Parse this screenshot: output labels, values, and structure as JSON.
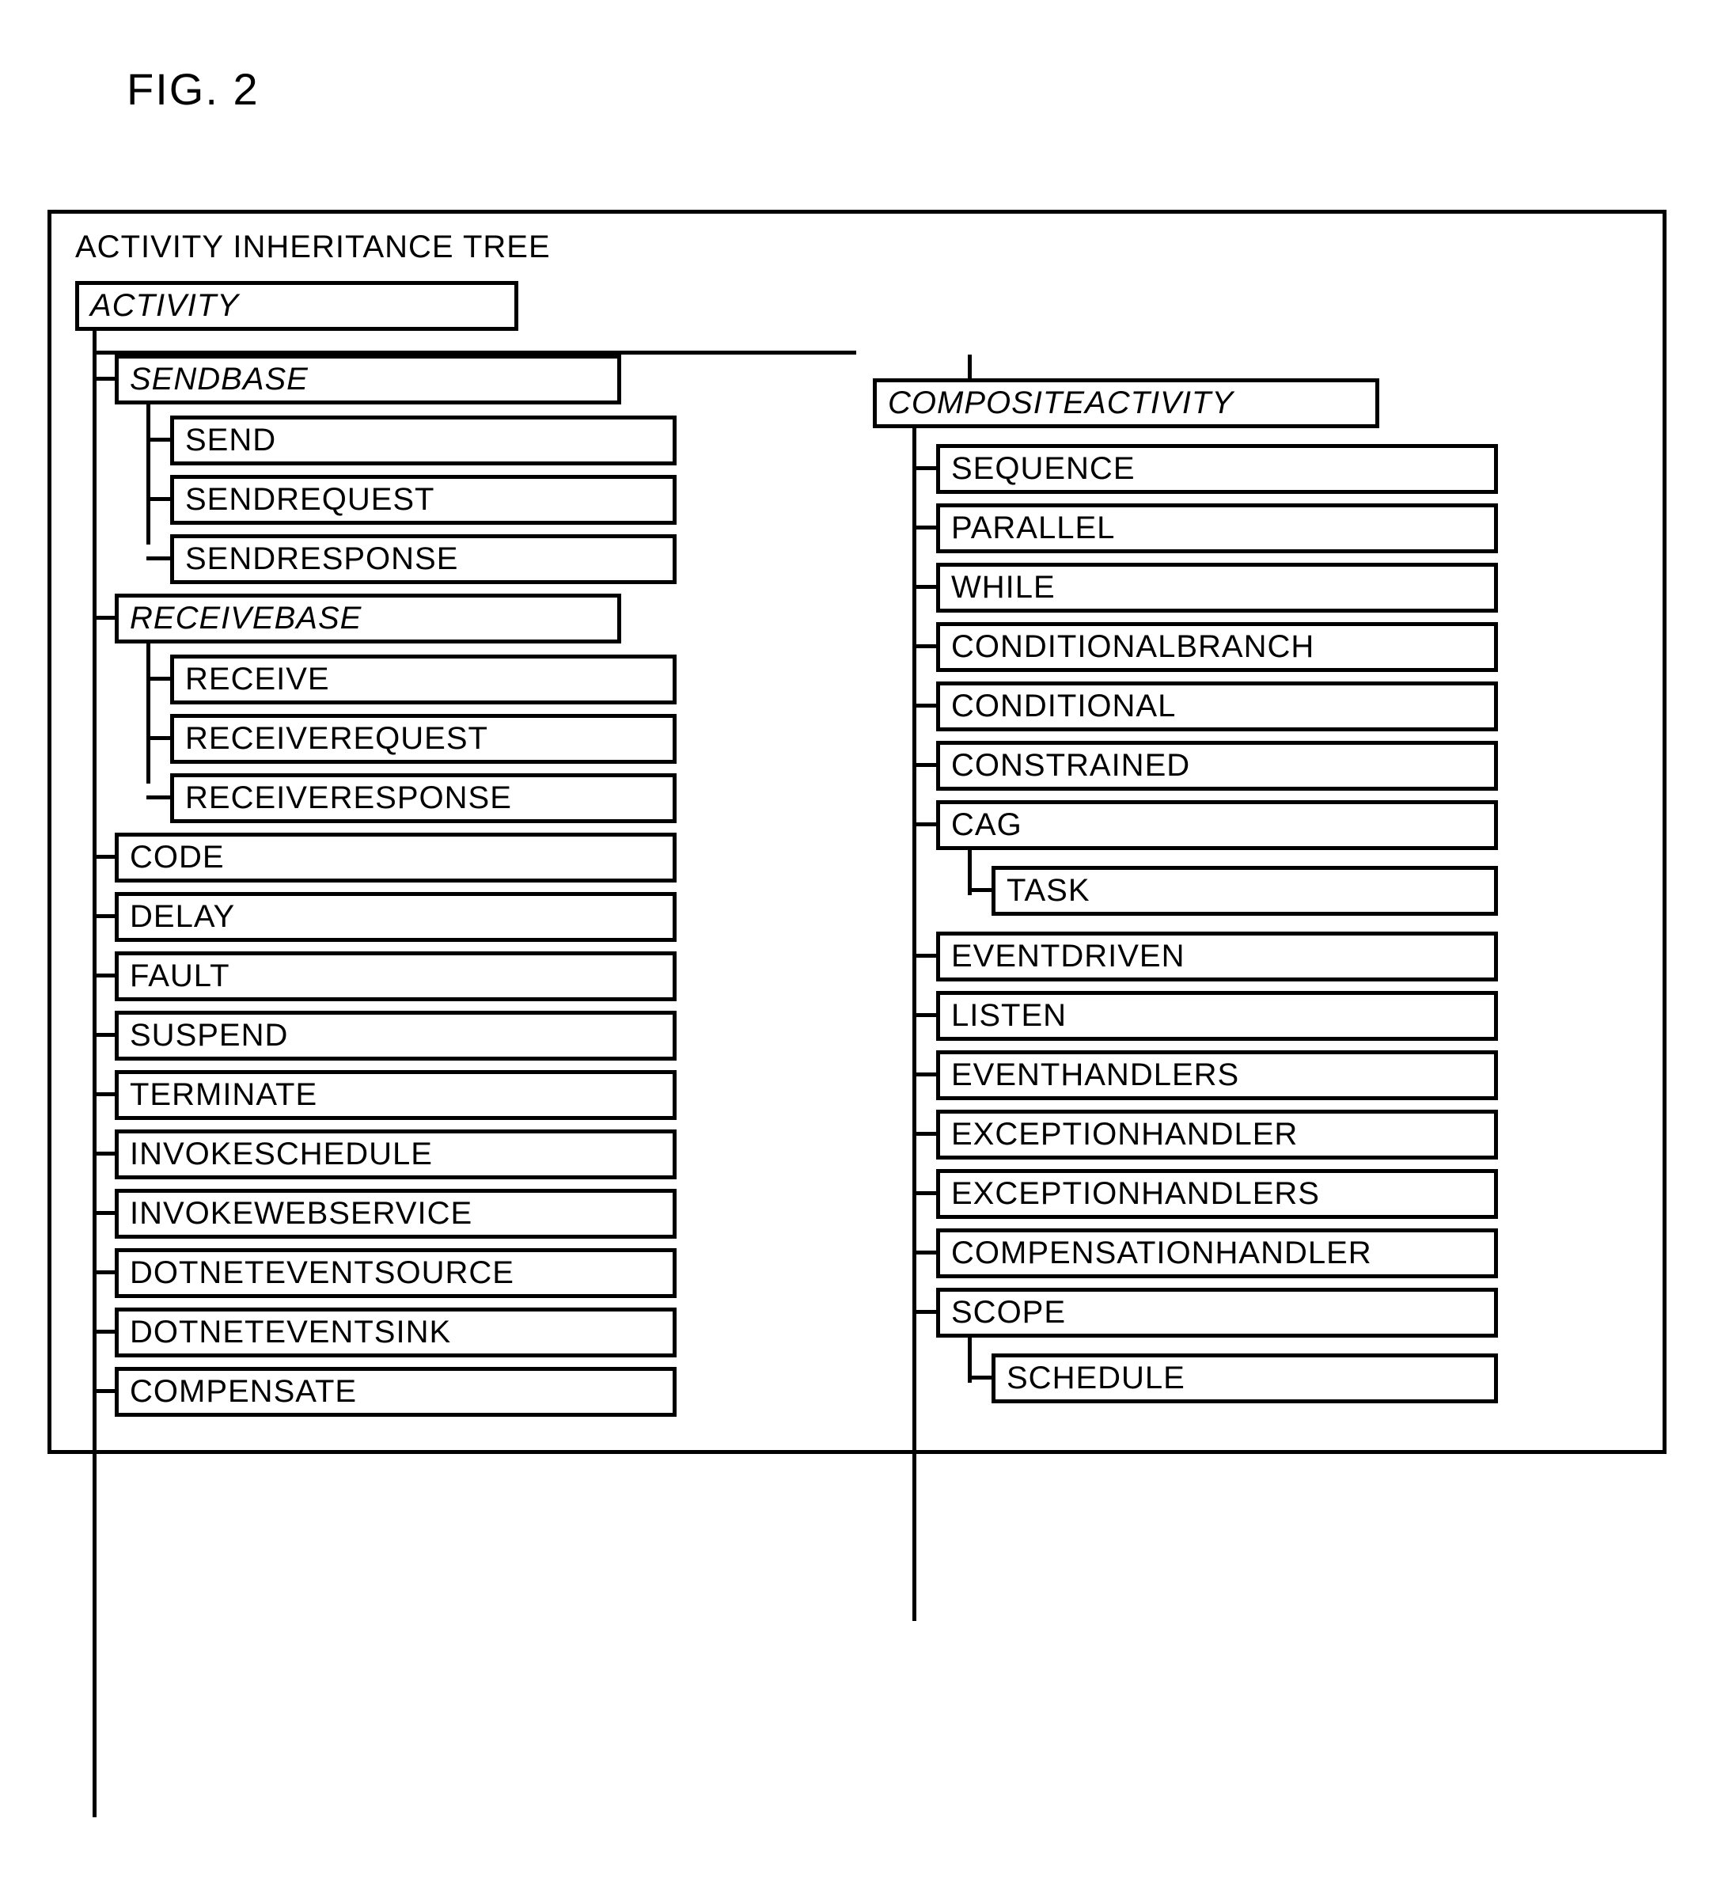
{
  "figure_label": "FIG. 2",
  "header": "ACTIVITY INHERITANCE TREE",
  "root": "ACTIVITY",
  "left": {
    "sendbase": {
      "label": "SENDBASE",
      "children": [
        "SEND",
        "SENDREQUEST",
        "SENDRESPONSE"
      ]
    },
    "receivebase": {
      "label": "RECEIVEBASE",
      "children": [
        "RECEIVE",
        "RECEIVEREQUEST",
        "RECEIVERESPONSE"
      ]
    },
    "simple": [
      "CODE",
      "DELAY",
      "FAULT",
      "SUSPEND",
      "TERMINATE",
      "INVOKESCHEDULE",
      "INVOKEWEBSERVICE",
      "DOTNETEVENTSOURCE",
      "DOTNETEVENTSINK",
      "COMPENSATE"
    ]
  },
  "right": {
    "composite": "COMPOSITEACTIVITY",
    "pre_cag": [
      "SEQUENCE",
      "PARALLEL",
      "WHILE",
      "CONDITIONALBRANCH",
      "CONDITIONAL",
      "CONSTRAINED"
    ],
    "cag": {
      "label": "CAG",
      "child": "TASK"
    },
    "post_cag": [
      "EVENTDRIVEN",
      "LISTEN",
      "EVENTHANDLERS",
      "EXCEPTIONHANDLER",
      "EXCEPTIONHANDLERS",
      "COMPENSATIONHANDLER"
    ],
    "scope": {
      "label": "SCOPE",
      "child": "SCHEDULE"
    }
  }
}
